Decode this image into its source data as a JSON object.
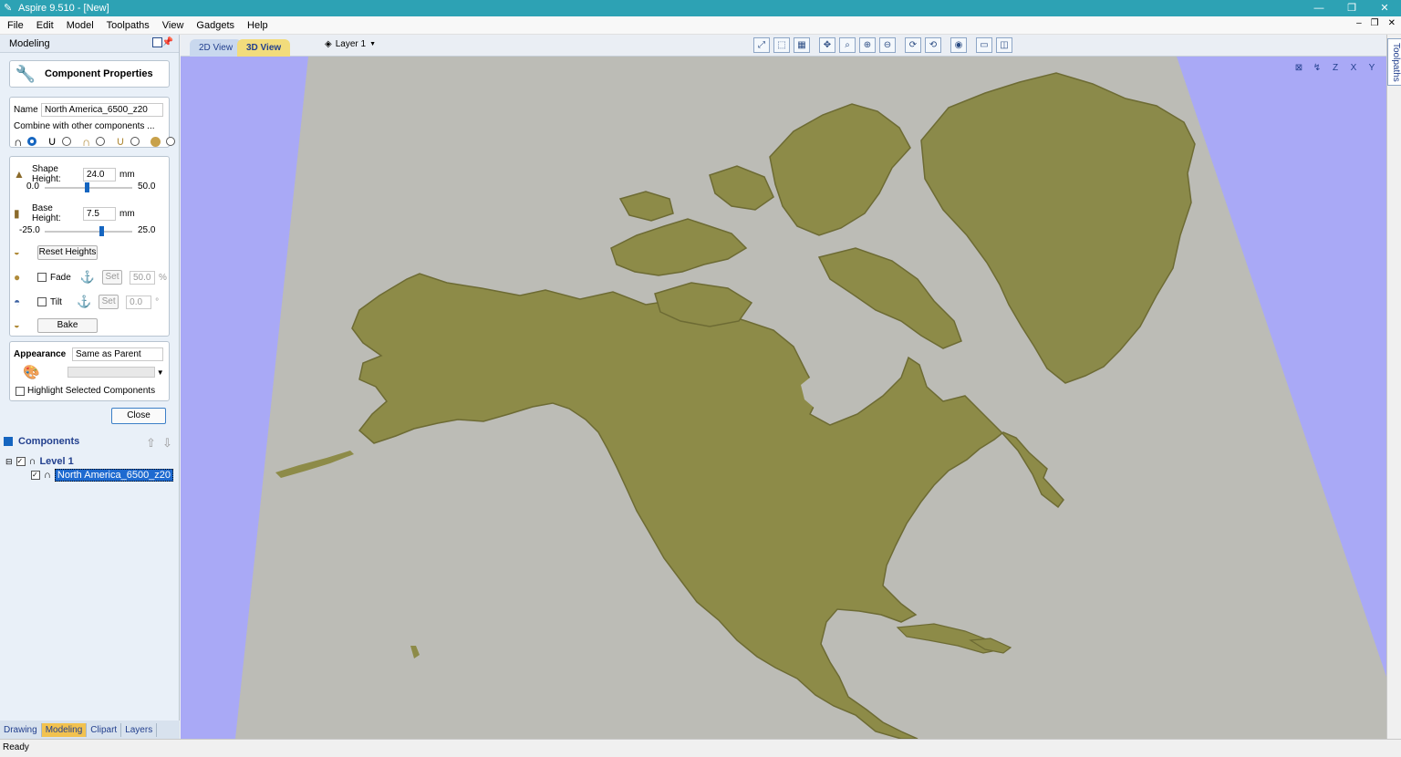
{
  "window": {
    "title": "Aspire 9.510 - [New]"
  },
  "menu": [
    "File",
    "Edit",
    "Model",
    "Toolpaths",
    "View",
    "Gadgets",
    "Help"
  ],
  "left_panel": {
    "header": "Modeling",
    "component_properties": "Component Properties",
    "name_label": "Name",
    "name_value": "North America_6500_z20",
    "combine_label": "Combine with other components ...",
    "shape_height_label": "Shape Height:",
    "shape_height_value": "24.0",
    "shape_height_unit": "mm",
    "shape_min": "0.0",
    "shape_max": "50.0",
    "shape_level": 0.48,
    "base_height_label": "Base Height:",
    "base_height_value": "7.5",
    "base_height_unit": "mm",
    "base_min": "-25.0",
    "base_max": "25.0",
    "base_level": 0.65,
    "reset_heights": "Reset Heights",
    "fade_label": "Fade",
    "fade_set": "Set",
    "fade_value": "50.0",
    "fade_unit": "%",
    "tilt_label": "Tilt",
    "tilt_set": "Set",
    "tilt_value": "0.0",
    "tilt_unit": "°",
    "bake": "Bake",
    "appearance_label": "Appearance",
    "appearance_value": "Same as Parent",
    "highlight_label": "Highlight Selected Components",
    "close": "Close",
    "components_title": "Components",
    "tree": {
      "level": "Level 1",
      "item": "North America_6500_z20"
    },
    "bottom_tabs": [
      "Drawing",
      "Modeling",
      "Clipart",
      "Layers"
    ]
  },
  "view": {
    "tab_2d": "2D View",
    "tab_3d": "3D View",
    "layer": "Layer 1",
    "right_strip_label": "Toolpaths"
  },
  "status": "Ready",
  "colors": {
    "accent": "#2da2b4",
    "terrain": "#8b8a4a",
    "plane": "#b8b8b2",
    "sky": "#a8a8f8"
  }
}
